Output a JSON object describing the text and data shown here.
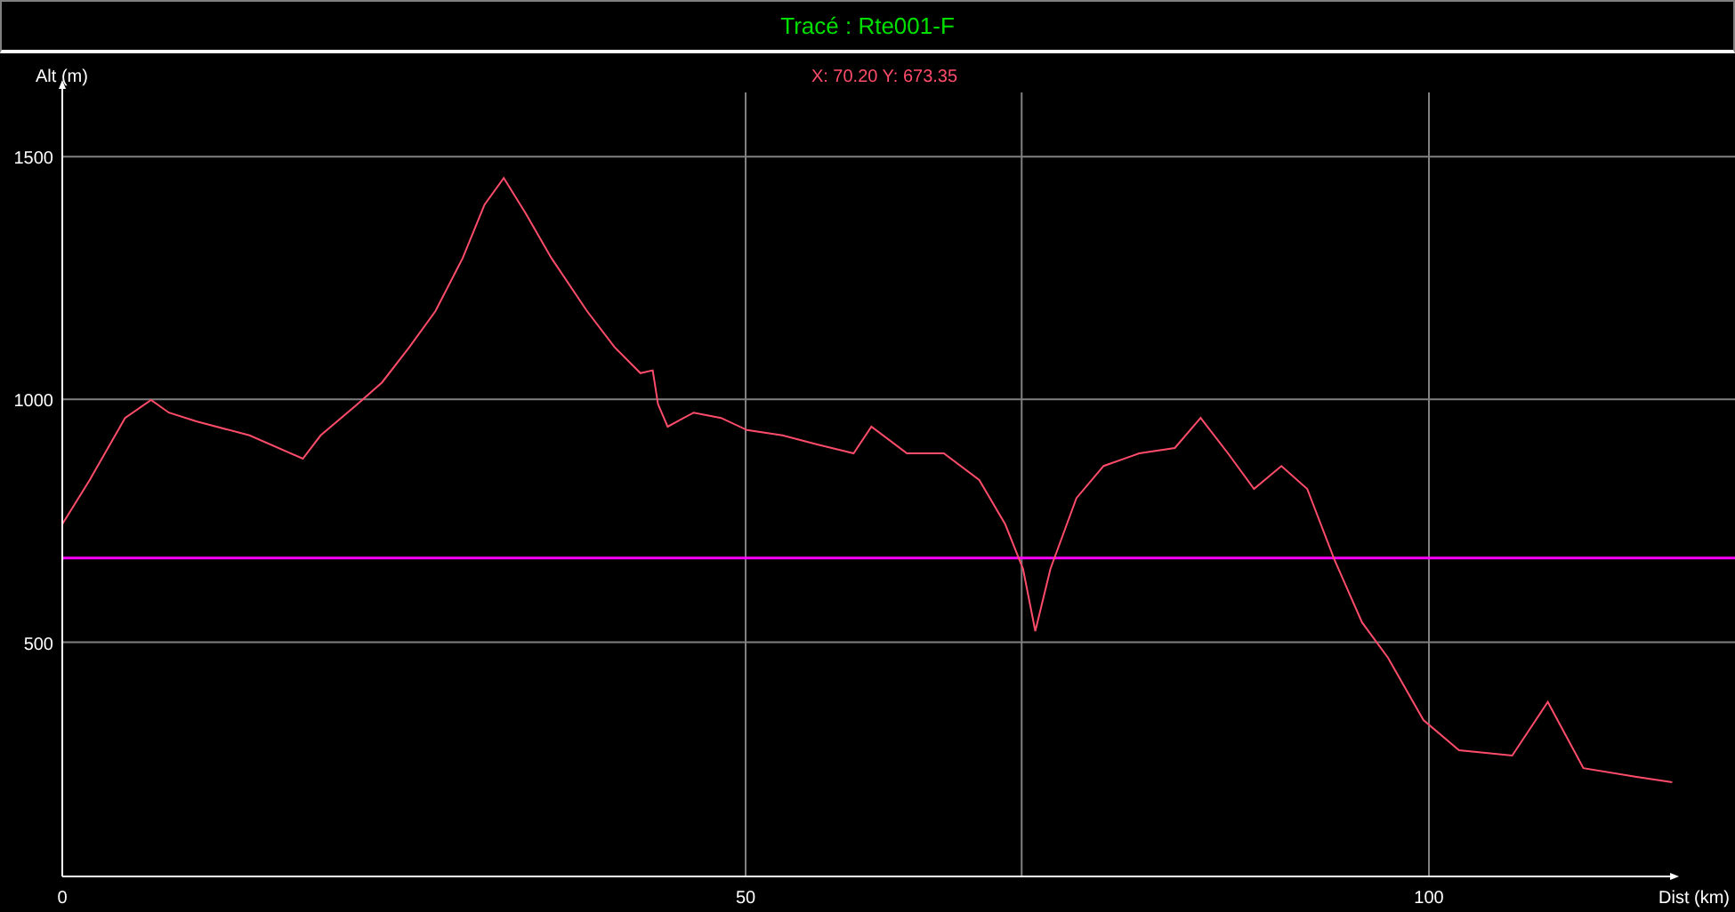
{
  "title_bar": {
    "title": "Tracé : Rte001-F"
  },
  "profile": {
    "cursor_readout": "X: 70.20 Y: 673.35",
    "chart_data": {
      "type": "line",
      "xlabel": "Dist (km)",
      "ylabel": "Alt (m)",
      "grid": true,
      "xlim": [
        0,
        118.3
      ],
      "ylim": [
        18,
        1632
      ],
      "xticks": [
        0,
        50,
        100
      ],
      "yticks": [
        500,
        1000,
        1500
      ],
      "x": [
        0,
        2,
        4.6,
        6.5,
        7.8,
        9.8,
        13.7,
        17.6,
        18.9,
        21.5,
        23.4,
        25.4,
        27.3,
        29.3,
        30.9,
        32.3,
        33.9,
        35.8,
        38.4,
        40.4,
        42.3,
        43.2,
        43.6,
        44.3,
        46.2,
        48.2,
        50.1,
        52.7,
        55.3,
        57.9,
        59.2,
        61.8,
        64.5,
        67.1,
        69,
        70.3,
        71.2,
        72.3,
        74.2,
        76.2,
        78.8,
        81.4,
        83.3,
        85.3,
        87.2,
        89.2,
        91.1,
        93.1,
        95.1,
        97,
        99.6,
        102.2,
        106.1,
        108.7,
        111.3,
        115.2,
        117.8
      ],
      "series": [
        {
          "color": "#ff4c6a",
          "values": [
            743,
            834,
            962,
            999,
            973,
            955,
            926,
            878,
            926,
            988,
            1035,
            1108,
            1182,
            1291,
            1401,
            1456,
            1383,
            1291,
            1182,
            1108,
            1054,
            1060,
            990,
            944,
            973,
            962,
            937,
            926,
            907,
            889,
            944,
            889,
            889,
            834,
            743,
            651,
            523,
            651,
            797,
            863,
            889,
            900,
            962,
            889,
            816,
            863,
            816,
            669,
            541,
            468,
            340,
            278,
            267,
            377,
            241,
            223,
            212
          ]
        }
      ],
      "ref_lines": [
        {
          "axis": "x",
          "value": 70.2,
          "color": "#808080"
        },
        {
          "axis": "y",
          "value": 673.35,
          "color": "#ff00ff"
        }
      ]
    }
  }
}
